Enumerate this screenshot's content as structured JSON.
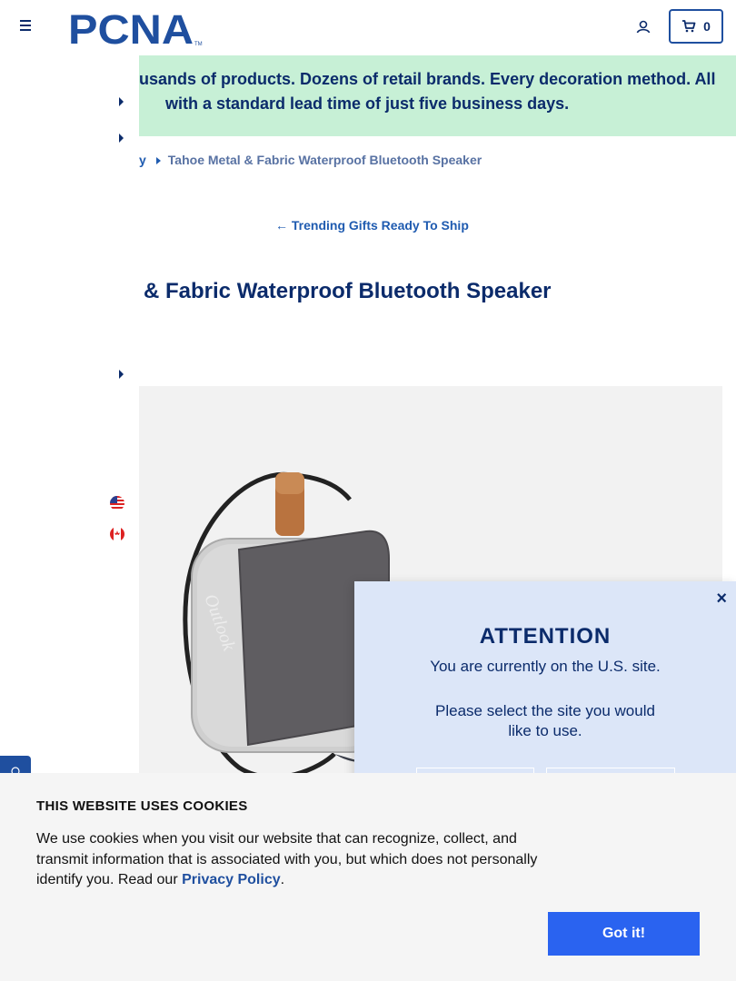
{
  "header": {
    "logo_text": "PCNA",
    "logo_tm": "TM",
    "cart_count": "0"
  },
  "banner": {
    "line1": "usands of products. Dozens of retail brands. Every decoration method. All",
    "line2": "with a standard lead time of just five business days."
  },
  "breadcrumb": {
    "previous": "y",
    "current": "Tahoe Metal & Fabric Waterproof Bluetooth Speaker"
  },
  "back_link": {
    "arrow": "←",
    "label": "Trending Gifts Ready To Ship"
  },
  "product": {
    "title": "& Fabric Waterproof Bluetooth Speaker",
    "image_engraving": "Outlook"
  },
  "site_modal": {
    "close": "×",
    "title": "ATTENTION",
    "line1": "You are currently on the U.S. site.",
    "line2": "Please select the site you would",
    "line3": "like to use."
  },
  "cookie_banner": {
    "title": "THIS WEBSITE USES COOKIES",
    "text_before": "We use cookies when you visit our website that can recognize, collect, and transmit information that is associated with you, but which does not personally identify you. Read our ",
    "link": "Privacy Policy",
    "text_after": ".",
    "button": "Got it!"
  },
  "colors": {
    "brand": "#1f4f9f",
    "navy": "#0b2b6b",
    "banner_bg": "#c7f0d6",
    "modal_bg": "#dce6f8",
    "cookie_button": "#2a63f0"
  },
  "icons": {
    "menu": "hamburger-icon",
    "account": "user-icon",
    "cart": "cart-icon",
    "flags": [
      "us-flag-icon",
      "canada-flag-icon"
    ],
    "feedback": "chat-icon"
  }
}
